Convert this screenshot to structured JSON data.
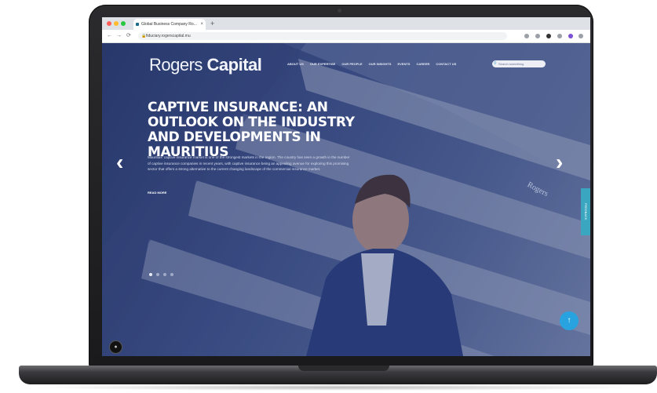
{
  "browser": {
    "tab_title": "Global Business Company Ro...",
    "tab_close": "×",
    "new_tab": "+",
    "url": "fiduciary.rogerscapital.mu",
    "nav": {
      "back": "←",
      "forward": "→",
      "reload": "⟳"
    },
    "window_dots": [
      "#ff5f57",
      "#febc2e",
      "#28c840"
    ]
  },
  "site": {
    "logo_light": "Rogers",
    "logo_bold": "Capital",
    "menu": [
      "ABOUT US",
      "OUR EXPERTISE",
      "OUR PEOPLE",
      "OUR INSIGHTS",
      "EVENTS",
      "CAREER",
      "CONTACT US"
    ],
    "search_placeholder": "Search something"
  },
  "hero": {
    "headline": "CAPTIVE INSURANCE: AN OUTLOOK ON THE INDUSTRY AND DEVELOPMENTS IN MAURITIUS",
    "excerpt": "Mauritius' captive insurance market is one of the strongest markets in the region. The country has seen a growth in the number of captive insurance companies in recent years, with captive insurance being an appealing avenue for exploring this promising sector that offers a strong alternative to the current changing landscape of the commercial insurance market.",
    "read_more": "READ MORE",
    "prev": "‹",
    "next": "›",
    "building_sign": "Rogers",
    "slides_count": 4
  },
  "widgets": {
    "feedback": "FEEDBACK",
    "scroll_top": "↑",
    "chat": "●"
  },
  "colors": {
    "accent": "#28a3e0",
    "overlay": "#24346e"
  }
}
